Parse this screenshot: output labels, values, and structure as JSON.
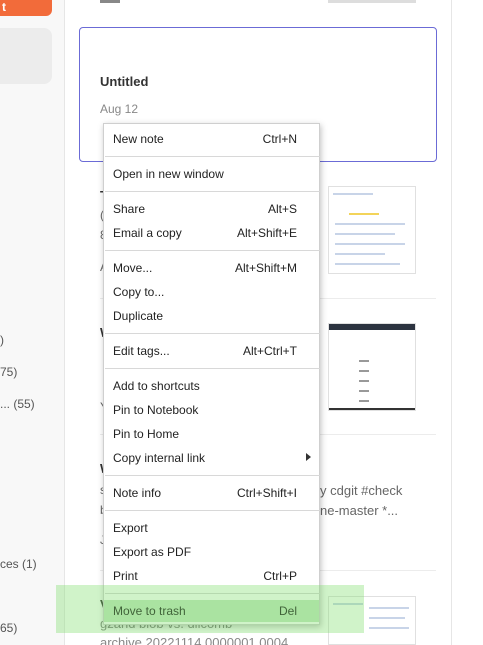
{
  "sidebar": {
    "new_button_label": "t",
    "items": [
      {
        "label": ")"
      },
      {
        "label": "75)"
      },
      {
        "label": "... (55)"
      },
      {
        "label": "ces (1)"
      },
      {
        "label": "65)"
      }
    ]
  },
  "notes": {
    "selected_card": {
      "title": "Untitled",
      "date": "Aug 12"
    },
    "fragments": {
      "t1": "T",
      "t2": "(",
      "t3": "8",
      "t4": "A",
      "w2": "W",
      "w2b": "Y",
      "w3": "W",
      "w3a": "s",
      "w3b": "b",
      "w3c": "J",
      "w3_text1": "y cdgit #check",
      "w3_text2": "ne-master *...",
      "w4": "V",
      "w4_text1": "gzand blob vs. dllcomb",
      "w4_text2": "archive 20221114 0000001 0004"
    }
  },
  "context_menu": {
    "items": [
      {
        "label": "New note",
        "shortcut": "Ctrl+N"
      },
      {
        "label": "Open in new window",
        "shortcut": ""
      },
      {
        "label": "Share",
        "shortcut": "Alt+S"
      },
      {
        "label": "Email a copy",
        "shortcut": "Alt+Shift+E"
      },
      {
        "label": "Move...",
        "shortcut": "Alt+Shift+M"
      },
      {
        "label": "Copy to...",
        "shortcut": ""
      },
      {
        "label": "Duplicate",
        "shortcut": ""
      },
      {
        "label": "Edit tags...",
        "shortcut": "Alt+Ctrl+T"
      },
      {
        "label": "Add to shortcuts",
        "shortcut": ""
      },
      {
        "label": "Pin to Notebook",
        "shortcut": ""
      },
      {
        "label": "Pin to Home",
        "shortcut": ""
      },
      {
        "label": "Copy internal link",
        "shortcut": "",
        "submenu": true
      },
      {
        "label": "Note info",
        "shortcut": "Ctrl+Shift+I"
      },
      {
        "label": "Export",
        "shortcut": ""
      },
      {
        "label": "Export as PDF",
        "shortcut": ""
      },
      {
        "label": "Print",
        "shortcut": "Ctrl+P"
      },
      {
        "label": "Move to trash",
        "shortcut": "Del"
      }
    ],
    "highlighted": "Move to trash"
  },
  "colors": {
    "accent": "#f26b3a",
    "selection_border": "#6b6bd6",
    "highlight": "#78dc64"
  }
}
